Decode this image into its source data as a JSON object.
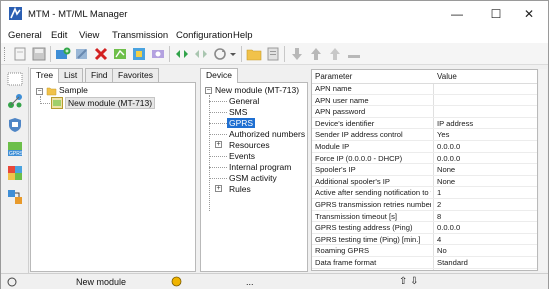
{
  "window": {
    "title": "MTM - MT/ML Manager"
  },
  "window_controls": {
    "minimize": "—",
    "maximize": "☐",
    "close": "✕"
  },
  "menu": [
    "General",
    "Edit",
    "View",
    "Transmission",
    "Configuration",
    "Help"
  ],
  "toolbar_icons": [
    "new-icon",
    "save-icon",
    "add-module-icon",
    "delete-icon",
    "configure-icon",
    "map-icon",
    "export-icon",
    "connect-icon",
    "disconnect-icon",
    "wizard-icon",
    "dropdown-arrow-icon",
    "folder-icon",
    "print-icon",
    "download-icon",
    "upload-icon",
    "upload-alt-icon",
    "sync-icon"
  ],
  "left_strip_icons": [
    "modules-icon",
    "network-icon",
    "shield-icon",
    "gprs-device-icon",
    "puzzle-icon",
    "flow-icon"
  ],
  "left_tabs": [
    "Tree",
    "List",
    "Find",
    "Favorites"
  ],
  "tree": {
    "root": "Sample",
    "child": "New module (MT-713)"
  },
  "device_tab": "Device",
  "device_tree": {
    "root": "New module (MT-713)",
    "items": [
      "General",
      "SMS",
      "GPRS",
      "Authorized numbers",
      "Resources",
      "Events",
      "Internal program",
      "GSM activity",
      "Rules"
    ]
  },
  "grid": {
    "header": {
      "param": "Parameter",
      "value": "Value"
    },
    "rows": [
      {
        "param": "APN name",
        "value": ""
      },
      {
        "param": "APN user name",
        "value": ""
      },
      {
        "param": "APN password",
        "value": ""
      },
      {
        "param": "Device's identifier",
        "value": "IP address"
      },
      {
        "param": "Sender IP address control",
        "value": "Yes"
      },
      {
        "param": "Module IP",
        "value": "0.0.0.0"
      },
      {
        "param": "Force IP (0.0.0.0 - DHCP)",
        "value": "0.0.0.0"
      },
      {
        "param": "Spooler's IP",
        "value": "None"
      },
      {
        "param": "Additional spooler's IP",
        "value": "None"
      },
      {
        "param": "Active after sending notification to t...",
        "value": "1"
      },
      {
        "param": "GPRS transmission retries number",
        "value": "2"
      },
      {
        "param": "Transmission timeout [s]",
        "value": "8"
      },
      {
        "param": "GPRS testing address (Ping)",
        "value": "0.0.0.0"
      },
      {
        "param": "GPRS testing time (Ping) [min.]",
        "value": "4"
      },
      {
        "param": "Roaming GPRS",
        "value": "No"
      },
      {
        "param": "Data frame format",
        "value": "Standard"
      }
    ]
  },
  "status": {
    "module": "New module",
    "text2": "...",
    "arrows": "⇧ ⇩"
  },
  "colors": {
    "selection": "#1f6fd1",
    "status_dot": "#f0b400"
  }
}
